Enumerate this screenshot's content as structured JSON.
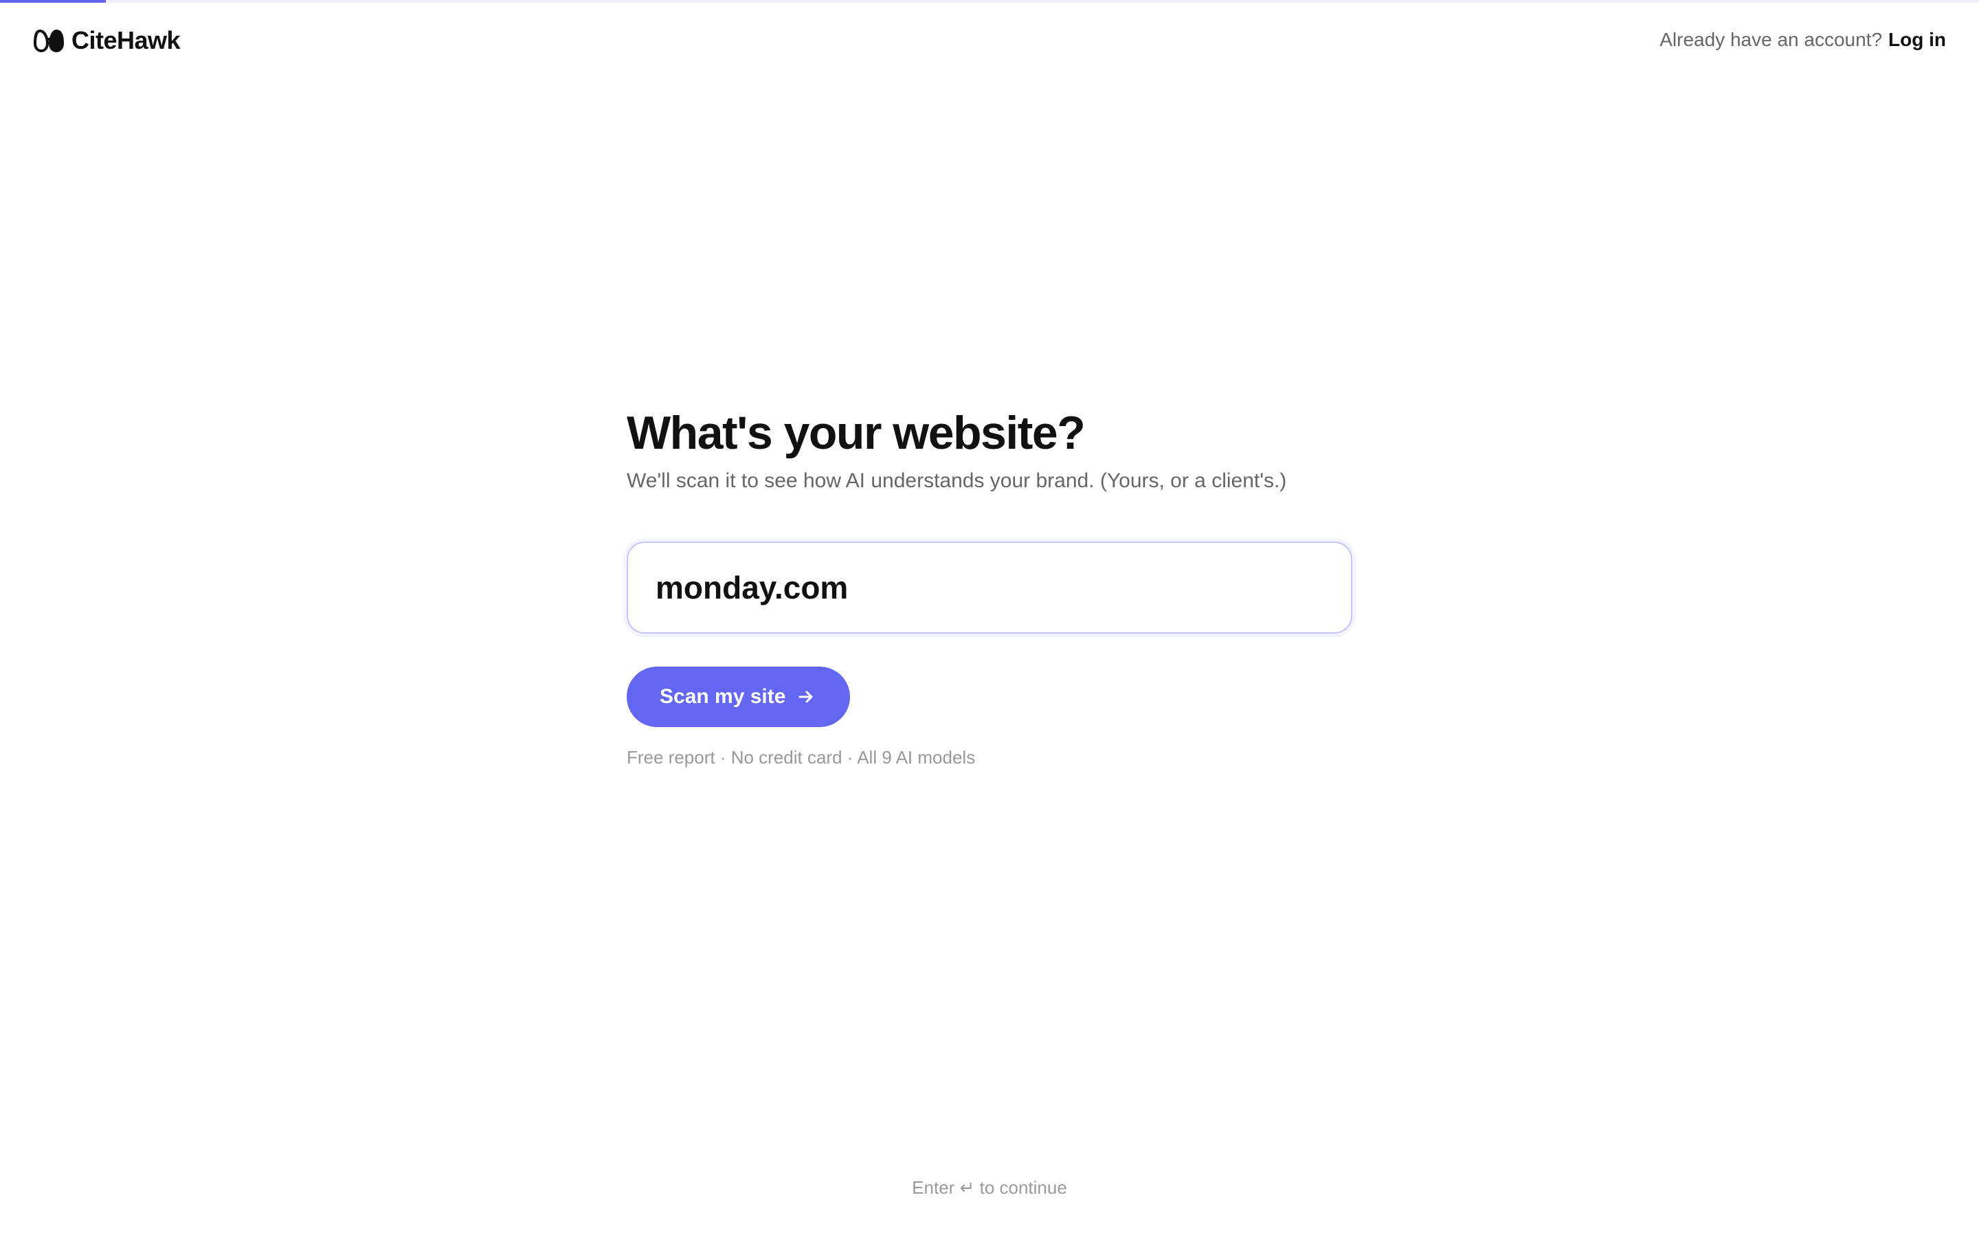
{
  "brand": {
    "name": "CiteHawk",
    "icon": "binoculars-icon"
  },
  "progress": {
    "fraction": 0.0535,
    "color": "#6366f1"
  },
  "header": {
    "login_prompt": "Already have an account?",
    "login_label": "Log in"
  },
  "main": {
    "title": "What's your website?",
    "subtitle": "We'll scan it to see how AI understands your brand. (Yours, or a client's.)",
    "url_input": {
      "value": "monday.com",
      "placeholder": ""
    },
    "scan_button_label": "Scan my site",
    "scan_button_icon": "arrow-right-icon",
    "fine_print": "Free report · No credit card · All 9 AI models"
  },
  "footer": {
    "hint_prefix": "Enter",
    "hint_icon": "enter-key-icon",
    "hint_glyph": "↵",
    "hint_suffix": "to continue"
  },
  "colors": {
    "accent": "#6366f1",
    "text": "#111111",
    "muted": "#666666"
  }
}
